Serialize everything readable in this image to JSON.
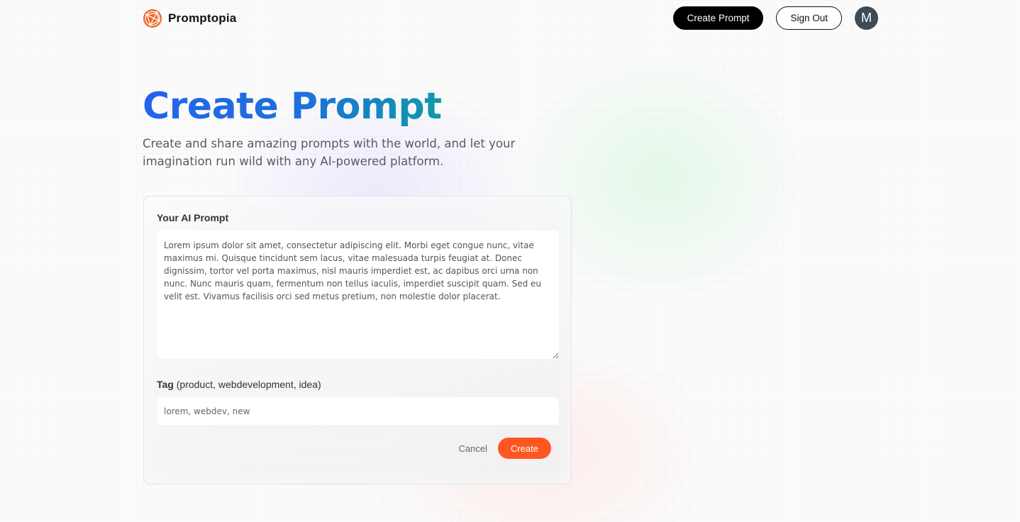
{
  "nav": {
    "brand": "Promptopia",
    "create_label": "Create Prompt",
    "signout_label": "Sign Out",
    "avatar_initial": "M"
  },
  "hero": {
    "title": "Create Prompt",
    "description": "Create and share amazing prompts with the world, and let your imagination run wild with any AI-powered platform."
  },
  "form": {
    "prompt_label": "Your AI Prompt",
    "prompt_value": "Lorem ipsum dolor sit amet, consectetur adipiscing elit. Morbi eget congue nunc, vitae maximus mi. Quisque tincidunt sem lacus, vitae malesuada turpis feugiat at. Donec dignissim, tortor vel porta maximus, nisl mauris imperdiet est, ac dapibus orci urna non nunc. Nunc mauris quam, fermentum non tellus iaculis, imperdiet suscipit quam. Sed eu velit est. Vivamus facilisis orci sed metus pretium, non molestie dolor placerat.",
    "tag_label": "Tag",
    "tag_hint": "(product, webdevelopment, idea)",
    "tag_placeholder": "lorem, webdev, new",
    "cancel_label": "Cancel",
    "submit_label": "Create"
  },
  "colors": {
    "accent": "#ff5722",
    "title_gradient_start": "#2563eb",
    "title_gradient_end": "#0e9aa7",
    "avatar_bg": "#3d4b55"
  },
  "icons": {
    "logo": "promptopia-logo-icon"
  }
}
